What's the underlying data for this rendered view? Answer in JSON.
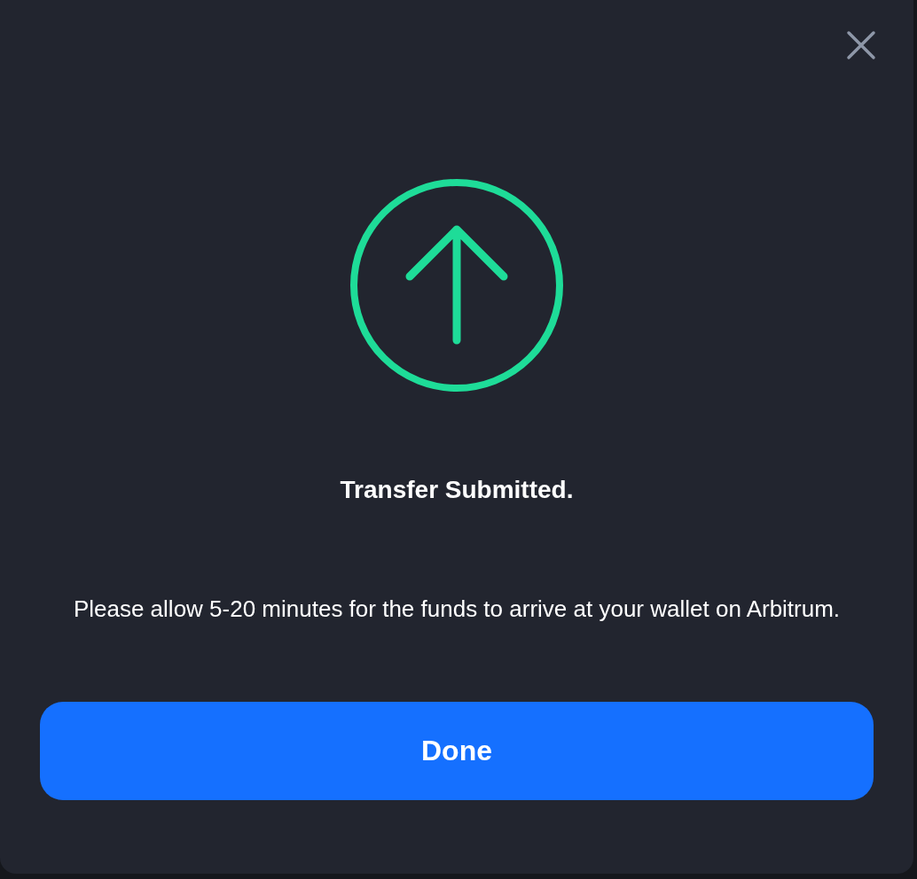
{
  "dialog": {
    "title": "Transfer Submitted.",
    "message": "Please allow 5-20 minutes for the funds to arrive at your wallet on Arbitrum.",
    "button": "Done"
  }
}
